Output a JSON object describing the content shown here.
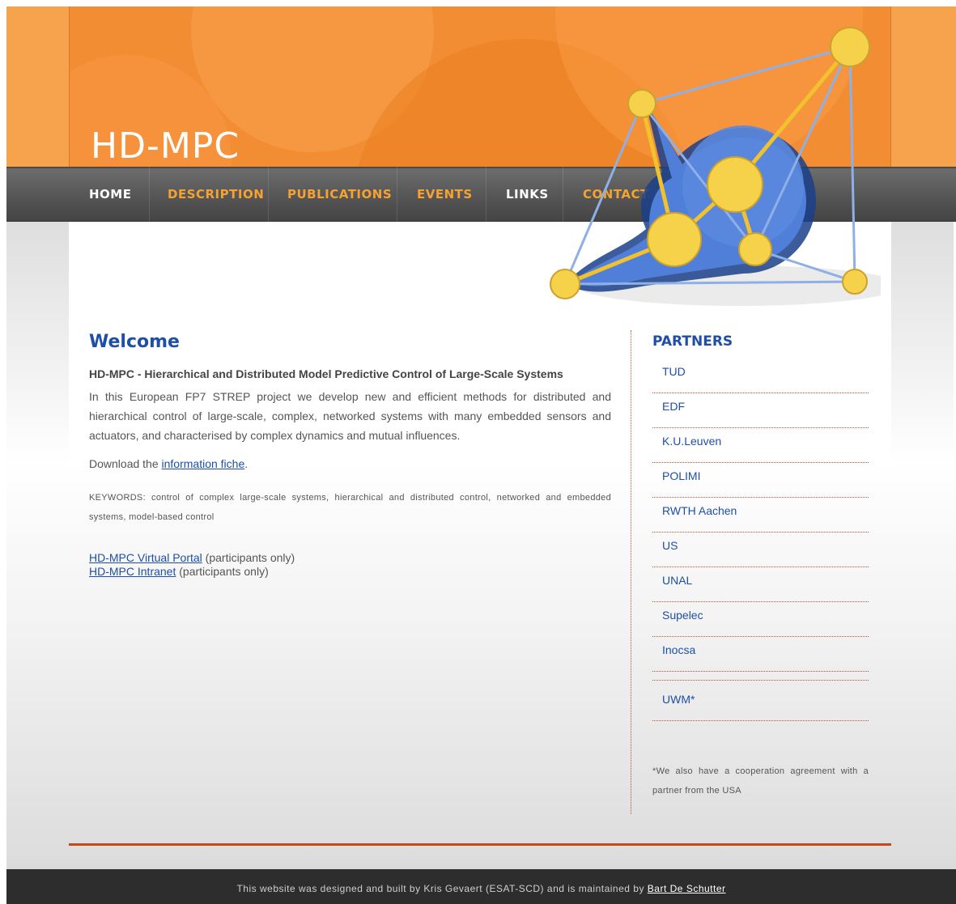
{
  "site": {
    "title": "HD-MPC"
  },
  "nav": {
    "items": [
      {
        "label": "HOME"
      },
      {
        "label": "DESCRIPTION"
      },
      {
        "label": "PUBLICATIONS"
      },
      {
        "label": "EVENTS"
      },
      {
        "label": "LINKS"
      },
      {
        "label": "CONTACT"
      }
    ]
  },
  "main": {
    "heading": "Welcome",
    "subtitle": "HD-MPC - Hierarchical and Distributed Model Predictive Control of Large-Scale Systems",
    "intro": "In this European FP7 STREP project we develop new and efficient methods for distributed and hierarchical control of large-scale, complex, networked systems with many embedded sensors and actuators, and characterised by complex dynamics and mutual influences.",
    "download_prefix": "Download the ",
    "download_link": "information fiche",
    "download_suffix": ".",
    "keywords": "KEYWORDS: control of complex large-scale systems, hierarchical and distributed control, networked and embedded systems, model-based control",
    "portal_link": "HD-MPC Virtual Portal",
    "portal_note": " (participants only)",
    "intranet_link": "HD-MPC Intranet",
    "intranet_note": " (participants only)"
  },
  "sidebar": {
    "heading": "PARTNERS",
    "partners": [
      "TUD",
      "EDF",
      "K.U.Leuven",
      "POLIMI",
      "RWTH Aachen",
      "US",
      "UNAL",
      "Supelec",
      "Inocsa",
      "UWM*"
    ],
    "note": "*We also have a cooperation agreement with a partner from the USA"
  },
  "footer": {
    "text": "This website was designed and built by Kris Gevaert (ESAT-SCD) and is maintained by ",
    "maintainer": "Bart De Schutter"
  },
  "colors": {
    "orange": "#f28d34",
    "nav_active": "#ffffff",
    "nav_inactive": "#f5a233",
    "link_blue": "#1d4fa8",
    "accent_red": "#c2481e"
  }
}
